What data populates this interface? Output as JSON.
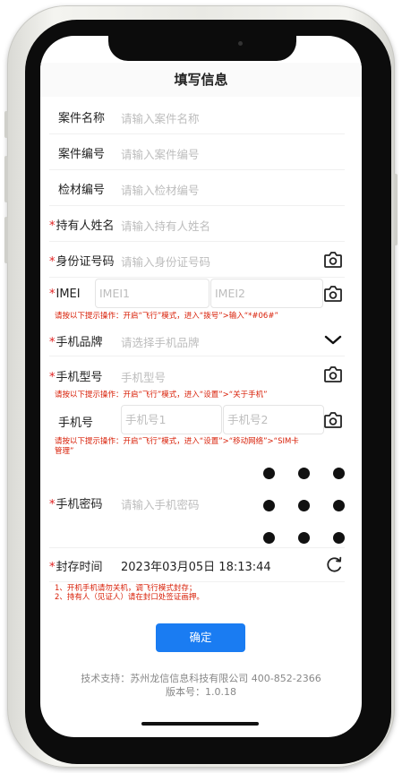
{
  "header": {
    "title": "填写信息"
  },
  "form": {
    "case_name": {
      "label": "案件名称",
      "placeholder": "请输入案件名称"
    },
    "case_no": {
      "label": "案件编号",
      "placeholder": "请输入案件编号"
    },
    "material_no": {
      "label": "检材编号",
      "placeholder": "请输入检材编号"
    },
    "holder_name": {
      "required": "*",
      "label": "持有人姓名",
      "placeholder": "请输入持有人姓名"
    },
    "id_no": {
      "required": "*",
      "label": "身份证号码",
      "placeholder": "请输入身份证号码"
    },
    "imei": {
      "required": "*",
      "label": "IMEI",
      "placeholder1": "IMEI1",
      "placeholder2": "IMEI2",
      "hint": "请按以下提示操作：开启“飞行”模式，进入“拨号”>输入“*#06#”"
    },
    "brand": {
      "required": "*",
      "label": "手机品牌",
      "placeholder": "请选择手机品牌"
    },
    "model": {
      "required": "*",
      "label": "手机型号",
      "placeholder": "手机型号",
      "hint": "请按以下提示操作：开启“飞行”模式，进入“设置”>“关于手机”"
    },
    "phone_no": {
      "label": "手机号",
      "placeholder1": "手机号1",
      "placeholder2": "手机号2",
      "hint_line1": "请按以下提示操作：开启“飞行”模式，进入“设置”>“移动网络”>“SIM卡",
      "hint_line2": "管理”"
    },
    "password": {
      "required": "*",
      "label": "手机密码",
      "placeholder": "请输入手机密码"
    },
    "seal_time": {
      "required": "*",
      "label": "封存时间",
      "value": "2023年03月05日 18:13:44"
    },
    "notes": {
      "line1": "1、开机手机请勿关机，调飞行模式封存；",
      "line2": "2、持有人（见证人）请在封口处签证画押。"
    }
  },
  "confirm_label": "确定",
  "footer": {
    "support": "技术支持：苏州龙信信息科技有限公司  400-852-2366",
    "version": "版本号：1.0.18"
  },
  "icons": {
    "camera": "camera-icon",
    "chevron": "chevron-down-icon",
    "refresh": "refresh-icon",
    "pattern": "pattern-lock-dots"
  }
}
